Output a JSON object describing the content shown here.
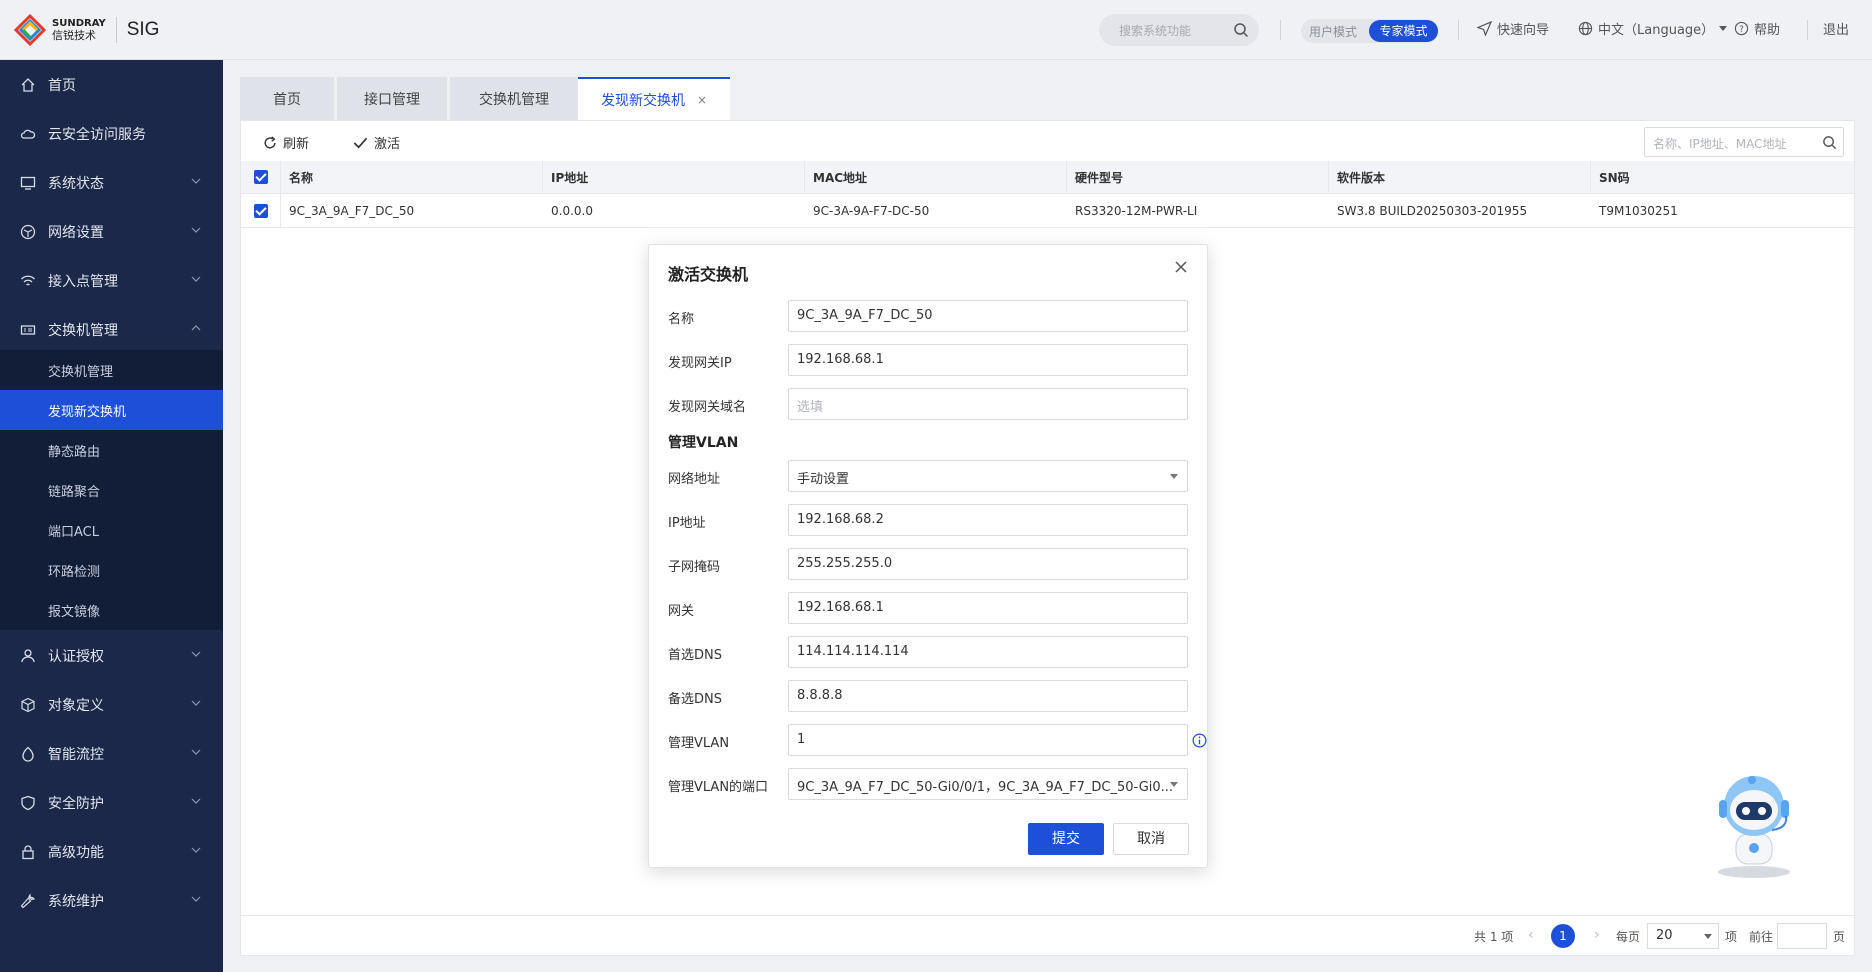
{
  "brand": {
    "line1": "SUNDRAY",
    "line2": "信锐技术",
    "app": "SIG"
  },
  "header": {
    "search_placeholder": "搜索系统功能",
    "mode_user": "用户模式",
    "mode_expert": "专家模式",
    "quick_guide": "快速向导",
    "language": "中文（Language）",
    "help": "帮助",
    "logout": "退出"
  },
  "sidebar": {
    "items": [
      {
        "label": "首页"
      },
      {
        "label": "云安全访问服务"
      },
      {
        "label": "系统状态"
      },
      {
        "label": "网络设置"
      },
      {
        "label": "接入点管理"
      },
      {
        "label": "交换机管理"
      },
      {
        "label": "认证授权"
      },
      {
        "label": "对象定义"
      },
      {
        "label": "智能流控"
      },
      {
        "label": "安全防护"
      },
      {
        "label": "高级功能"
      },
      {
        "label": "系统维护"
      }
    ],
    "sub_items": [
      {
        "label": "交换机管理"
      },
      {
        "label": "发现新交换机"
      },
      {
        "label": "静态路由"
      },
      {
        "label": "链路聚合"
      },
      {
        "label": "端口ACL"
      },
      {
        "label": "环路检测"
      },
      {
        "label": "报文镜像"
      }
    ]
  },
  "tabs": [
    {
      "label": "首页"
    },
    {
      "label": "接口管理"
    },
    {
      "label": "交换机管理"
    },
    {
      "label": "发现新交换机",
      "close": "×"
    }
  ],
  "toolbar": {
    "refresh": "刷新",
    "activate": "激活",
    "search_placeholder": "名称、IP地址、MAC地址"
  },
  "table": {
    "columns": [
      "名称",
      "IP地址",
      "MAC地址",
      "硬件型号",
      "软件版本",
      "SN码"
    ],
    "rows": [
      [
        "9C_3A_9A_F7_DC_50",
        "0.0.0.0",
        "9C-3A-9A-F7-DC-50",
        "RS3320-12M-PWR-LI",
        "SW3.8 BUILD20250303-201955",
        "T9M1030251"
      ]
    ]
  },
  "pagination": {
    "total": "共 1 项",
    "current_page": "1",
    "per_page_label": "每页",
    "per_page": "20",
    "per_page_unit": "项",
    "goto_label": "前往",
    "page_unit": "页"
  },
  "dialog": {
    "title": "激活交换机",
    "fields": {
      "name": {
        "label": "名称",
        "value": "9C_3A_9A_F7_DC_50"
      },
      "gw_ip": {
        "label": "发现网关IP",
        "value": "192.168.68.1"
      },
      "gw_domain": {
        "label": "发现网关域名",
        "placeholder": "选填"
      },
      "net_addr": {
        "label": "网络地址",
        "value": "手动设置"
      },
      "ip": {
        "label": "IP地址",
        "value": "192.168.68.2"
      },
      "mask": {
        "label": "子网掩码",
        "value": "255.255.255.0"
      },
      "gateway": {
        "label": "网关",
        "value": "192.168.68.1"
      },
      "dns1": {
        "label": "首选DNS",
        "value": "114.114.114.114"
      },
      "dns2": {
        "label": "备选DNS",
        "value": "8.8.8.8"
      },
      "vlan": {
        "label": "管理VLAN",
        "value": "1"
      },
      "vlan_ports": {
        "label": "管理VLAN的端口",
        "value": "9C_3A_9A_F7_DC_50-Gi0/0/1，9C_3A_9A_F7_DC_50-Gi0..."
      }
    },
    "section_vlan": "管理VLAN",
    "submit": "提交",
    "cancel": "取消"
  },
  "colors": {
    "accent": "#1d4fd8",
    "sidebar_bg": "#1b2849",
    "sidebar_sub_bg": "#121d38"
  }
}
